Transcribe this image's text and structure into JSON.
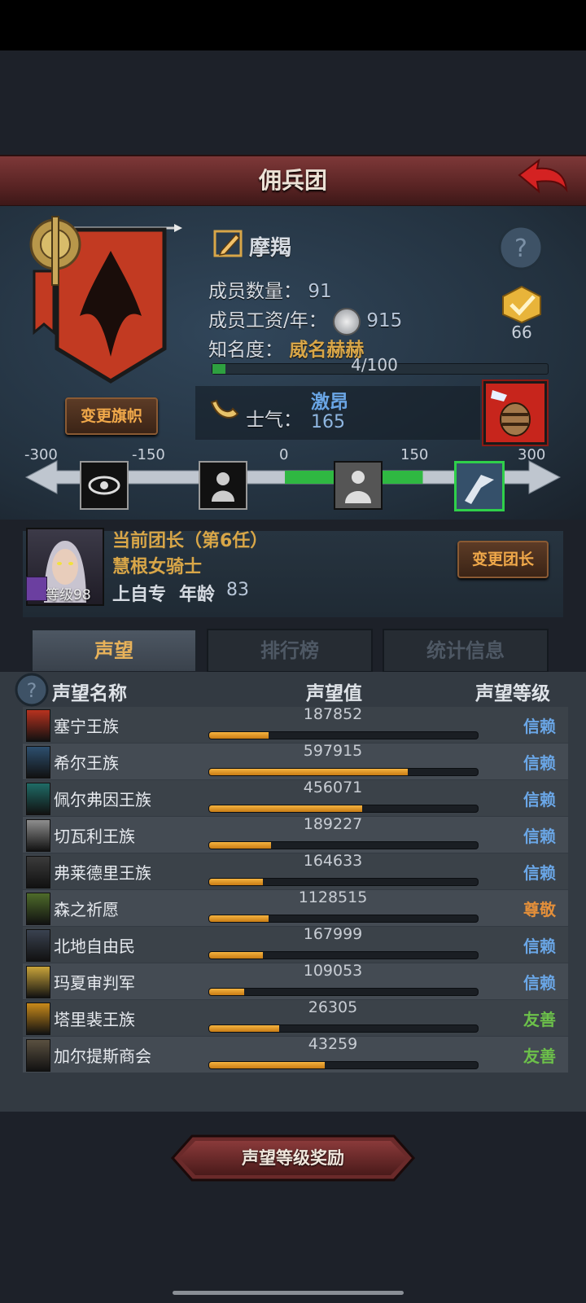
{
  "title": "佣兵团",
  "band": {
    "name": "摩羯",
    "members_label": "成员数量：",
    "members_value": "91",
    "wage_label": "成员工资/年：",
    "wage_value": "915",
    "fame_label": "知名度：",
    "fame_value": "威名赫赫",
    "fame_progress_text": "4/100",
    "fame_progress": 0.04,
    "badge_count": "66",
    "change_flag_label": "变更旗帜"
  },
  "morale": {
    "label": "士气：",
    "state": "激昂",
    "value": "165",
    "scale_ticks": [
      "-300",
      "-150",
      "0",
      "150",
      "300"
    ],
    "value_fraction": 0.775
  },
  "leader": {
    "heading": "当前团长（第6任）",
    "name": "慧根女骑士",
    "level_text": "等级98",
    "trait": "上自专",
    "age_label": "年龄",
    "age_value": "83",
    "change_leader_label": "变更团长"
  },
  "tabs": [
    "声望",
    "排行榜",
    "统计信息"
  ],
  "table": {
    "headers": [
      "声望名称",
      "声望值",
      "声望等级"
    ],
    "rows": [
      {
        "name": "塞宁王族",
        "value": "187852",
        "level": "信赖",
        "fill": 0.22,
        "level_color": "#6aa6e6",
        "crest": "#b8321f"
      },
      {
        "name": "希尔王族",
        "value": "597915",
        "level": "信赖",
        "fill": 0.74,
        "level_color": "#6aa6e6",
        "crest": "#2d4f6e"
      },
      {
        "name": "佩尔弗因王族",
        "value": "456071",
        "level": "信赖",
        "fill": 0.57,
        "level_color": "#6aa6e6",
        "crest": "#1f6b66"
      },
      {
        "name": "切瓦利王族",
        "value": "189227",
        "level": "信赖",
        "fill": 0.23,
        "level_color": "#6aa6e6",
        "crest": "#8e8e8e"
      },
      {
        "name": "弗莱德里王族",
        "value": "164633",
        "level": "信赖",
        "fill": 0.2,
        "level_color": "#6aa6e6",
        "crest": "#3b3b3b"
      },
      {
        "name": "森之祈愿",
        "value": "1128515",
        "level": "尊敬",
        "fill": 0.22,
        "level_color": "#e38f3a",
        "crest": "#4e6b2a"
      },
      {
        "name": "北地自由民",
        "value": "167999",
        "level": "信赖",
        "fill": 0.2,
        "level_color": "#6aa6e6",
        "crest": "#3a4250"
      },
      {
        "name": "玛夏审判军",
        "value": "109053",
        "level": "信赖",
        "fill": 0.13,
        "level_color": "#6aa6e6",
        "crest": "#c9a43a"
      },
      {
        "name": "塔里裴王族",
        "value": "26305",
        "level": "友善",
        "fill": 0.26,
        "level_color": "#6cc04a",
        "crest": "#c98a1a"
      },
      {
        "name": "加尔提斯商会",
        "value": "43259",
        "level": "友善",
        "fill": 0.43,
        "level_color": "#6cc04a",
        "crest": "#5a5040"
      }
    ]
  },
  "reward_button": "声望等级奖励"
}
